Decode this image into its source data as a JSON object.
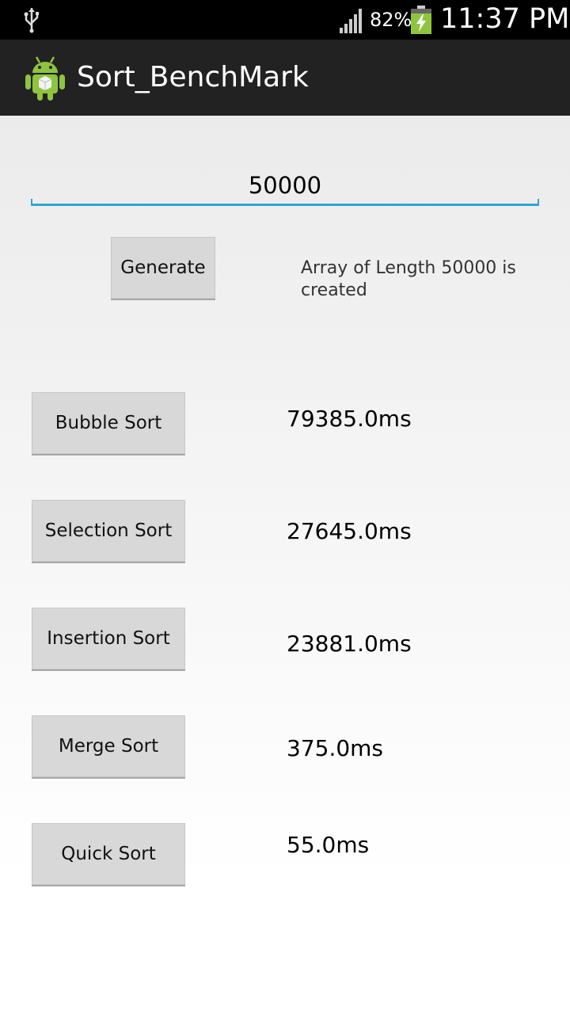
{
  "status_bar": {
    "battery_percent": "82%",
    "time": "11:37 PM",
    "icons": [
      "usb-icon",
      "signal-icon",
      "battery-charging-icon"
    ]
  },
  "action_bar": {
    "title": "Sort_BenchMark",
    "icon": "android-app-icon"
  },
  "input": {
    "array_length_value": "50000"
  },
  "generate": {
    "label": "Generate",
    "status": "Array of Length 50000 is created"
  },
  "sorts": [
    {
      "label": "Bubble Sort",
      "time": "79385.0ms"
    },
    {
      "label": "Selection Sort",
      "time": "27645.0ms"
    },
    {
      "label": "Insertion Sort",
      "time": "23881.0ms"
    },
    {
      "label": "Merge Sort",
      "time": "375.0ms"
    },
    {
      "label": "Quick Sort",
      "time": "55.0ms"
    }
  ],
  "colors": {
    "field_underline": "#33a5cf",
    "action_bar_bg": "#222222",
    "status_bar_bg": "#000000",
    "battery_green": "#8fc43e"
  }
}
